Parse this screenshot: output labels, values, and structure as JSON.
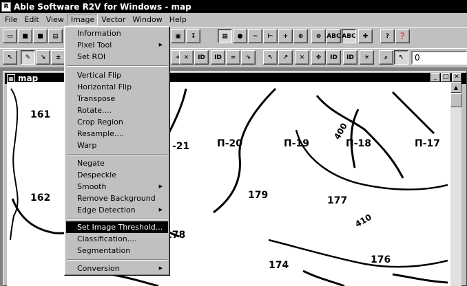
{
  "window": {
    "title": "Able Software R2V for Windows - map"
  },
  "menubar": [
    "File",
    "Edit",
    "View",
    "Image",
    "Vector",
    "Window",
    "Help"
  ],
  "toolbar2": {
    "field_value": "0"
  },
  "child_window": {
    "title": "map"
  },
  "image_menu": {
    "groups": [
      [
        {
          "label": "Information",
          "submenu": false
        },
        {
          "label": "Pixel Tool",
          "submenu": true
        },
        {
          "label": "Set ROI",
          "submenu": false
        }
      ],
      [
        {
          "label": "Vertical Flip",
          "submenu": false
        },
        {
          "label": "Horizontal Flip",
          "submenu": false
        },
        {
          "label": "Transpose",
          "submenu": false
        },
        {
          "label": "Rotate....",
          "submenu": false
        },
        {
          "label": "Crop Region",
          "submenu": false
        },
        {
          "label": "Resample....",
          "submenu": false
        },
        {
          "label": "Warp",
          "submenu": false
        }
      ],
      [
        {
          "label": "Negate",
          "submenu": false
        },
        {
          "label": "Despeckle",
          "submenu": false
        },
        {
          "label": "Smooth",
          "submenu": true
        },
        {
          "label": "Remove Background",
          "submenu": false
        },
        {
          "label": "Edge Detection",
          "submenu": true
        }
      ],
      [
        {
          "label": "Set Image Threshold...",
          "submenu": false,
          "highlighted": true
        },
        {
          "label": "Classification....",
          "submenu": false
        },
        {
          "label": "Segmentation",
          "submenu": false
        }
      ],
      [
        {
          "label": "Conversion",
          "submenu": true
        }
      ]
    ]
  },
  "map": {
    "labels": [
      "161",
      "162",
      "179",
      "177",
      "174",
      "176",
      "178",
      "-21",
      "П-20",
      "П-19",
      "П-18",
      "П-17",
      "400",
      "410"
    ]
  }
}
